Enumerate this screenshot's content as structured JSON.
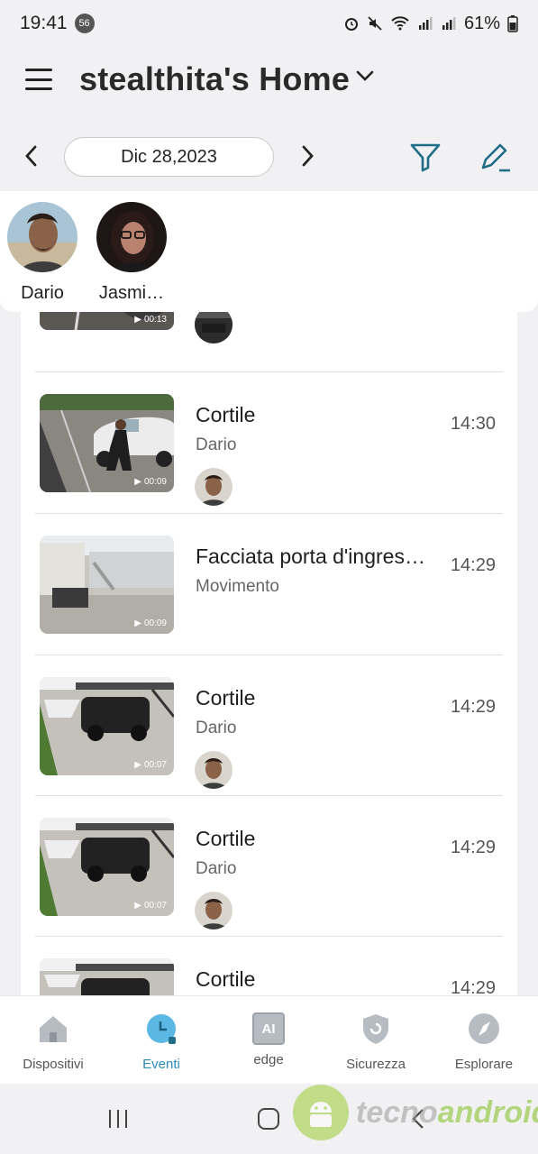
{
  "status_bar": {
    "time": "19:41",
    "notif_count": "56",
    "battery": "61%"
  },
  "header": {
    "title": "stealthita's Home"
  },
  "date_nav": {
    "date": "Dic 28,2023"
  },
  "people": [
    {
      "name": "Dario"
    },
    {
      "name": "Jasmi…"
    }
  ],
  "events": [
    {
      "title": "",
      "subtitle": "",
      "time": "",
      "duration": "00:13"
    },
    {
      "title": "Cortile",
      "subtitle": "Dario",
      "time": "14:30",
      "duration": "00:09"
    },
    {
      "title": "Facciata porta d'ingres…",
      "subtitle": "Movimento",
      "time": "14:29",
      "duration": "00:09"
    },
    {
      "title": "Cortile",
      "subtitle": "Dario",
      "time": "14:29",
      "duration": "00:07"
    },
    {
      "title": "Cortile",
      "subtitle": "Dario",
      "time": "14:29",
      "duration": "00:07"
    },
    {
      "title": "Cortile",
      "subtitle": "",
      "time": "14:29",
      "duration": ""
    }
  ],
  "bottom_nav": {
    "items": [
      {
        "label": "Dispositivi",
        "icon": "home-icon"
      },
      {
        "label": "Eventi",
        "icon": "clock-icon"
      },
      {
        "label": "edge",
        "icon": "ai-chip-icon",
        "icon_text": "AI"
      },
      {
        "label": "Sicurezza",
        "icon": "shield-icon"
      },
      {
        "label": "Esplorare",
        "icon": "compass-icon"
      }
    ],
    "active": "Eventi"
  },
  "watermark": {
    "part1": "tecno",
    "part2": "android"
  },
  "colors": {
    "accent": "#2d8bb8",
    "icon_teal": "#1f6d86",
    "watermark_green": "#7fbf1f"
  }
}
